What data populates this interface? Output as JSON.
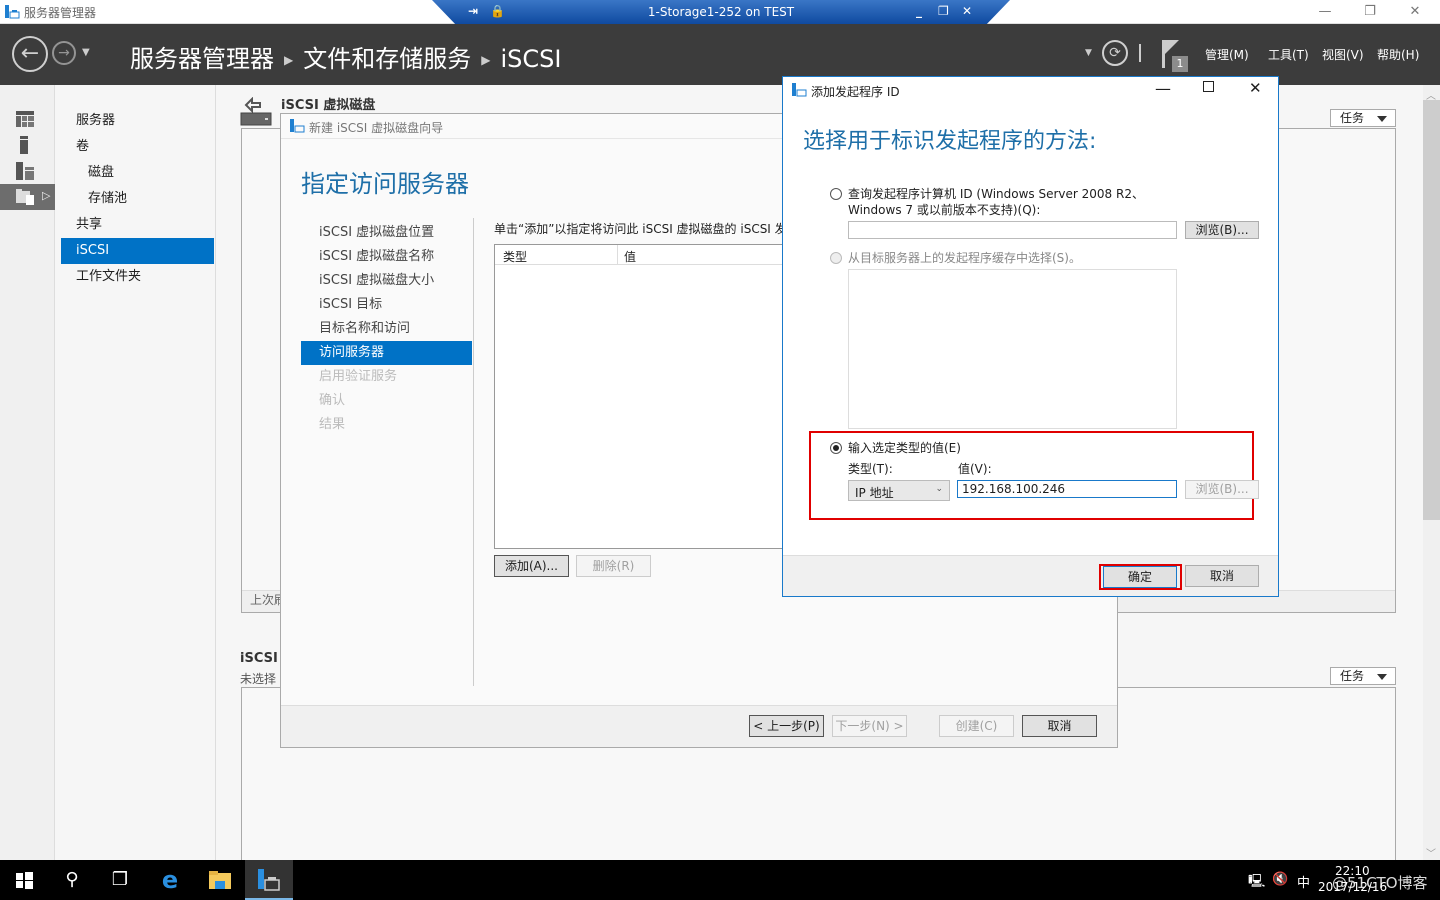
{
  "window": {
    "app_title": "服务器管理器",
    "rdp_title": "1-Storage1-252 on TEST",
    "controls": {
      "minimize": "—",
      "restore": "❐",
      "close": "✕"
    }
  },
  "header": {
    "breadcrumb": [
      "服务器管理器",
      "文件和存储服务",
      "iSCSI"
    ],
    "notification_count": "1",
    "menus": [
      "管理(M)",
      "工具(T)",
      "视图(V)",
      "帮助(H)"
    ]
  },
  "rail": {
    "items": [
      "dashboard-icon",
      "local-server-icon",
      "all-servers-icon",
      "file-storage-icon"
    ]
  },
  "nav": {
    "items": [
      {
        "label": "服务器",
        "sub": false,
        "active": false
      },
      {
        "label": "卷",
        "sub": false,
        "active": false
      },
      {
        "label": "磁盘",
        "sub": true,
        "active": false
      },
      {
        "label": "存储池",
        "sub": true,
        "active": false
      },
      {
        "label": "共享",
        "sub": false,
        "active": false
      },
      {
        "label": "iSCSI",
        "sub": false,
        "active": true
      },
      {
        "label": "工作文件夹",
        "sub": false,
        "active": false
      }
    ]
  },
  "content": {
    "section1_title": "iSCSI 虚拟磁盘",
    "section1_footer": "上次刷",
    "section2_title": "iSCSI",
    "section2_sub": "未选择",
    "tasks_label": "任务"
  },
  "wizard": {
    "title": "新建 iSCSI 虚拟磁盘向导",
    "heading": "指定访问服务器",
    "steps": [
      {
        "label": "iSCSI 虚拟磁盘位置",
        "state": "done"
      },
      {
        "label": "iSCSI 虚拟磁盘名称",
        "state": "done"
      },
      {
        "label": "iSCSI 虚拟磁盘大小",
        "state": "done"
      },
      {
        "label": "iSCSI 目标",
        "state": "done"
      },
      {
        "label": "目标名称和访问",
        "state": "done"
      },
      {
        "label": "访问服务器",
        "state": "active"
      },
      {
        "label": "启用验证服务",
        "state": "disabled"
      },
      {
        "label": "确认",
        "state": "disabled"
      },
      {
        "label": "结果",
        "state": "disabled"
      }
    ],
    "instruction": "单击“添加”以指定将访问此 iSCSI 虚拟磁盘的 iSCSI 发起程序。",
    "table_headers": [
      "类型",
      "值"
    ],
    "add_button": "添加(A)...",
    "remove_button": "删除(R)",
    "prev_button": "< 上一步(P)",
    "next_button": "下一步(N) >",
    "create_button": "创建(C)",
    "cancel_button": "取消"
  },
  "dialog": {
    "title": "添加发起程序 ID",
    "heading": "选择用于标识发起程序的方法:",
    "option1_line1": "查询发起程序计算机 ID (Windows Server 2008 R2、",
    "option1_line2": "Windows 7 或以前版本不支持)(Q):",
    "option1_value": "",
    "browse1": "浏览(B)...",
    "option2": "从目标服务器上的发起程序缓存中选择(S)。",
    "option3": "输入选定类型的值(E)",
    "type_label": "类型(T):",
    "type_value": "IP 地址",
    "value_label": "值(V):",
    "value": "192.168.100.246",
    "browse3": "浏览(B)...",
    "ok": "确定",
    "cancel": "取消",
    "selected_option": 3
  },
  "taskbar": {
    "time": "22:10",
    "date": "2017/12/16",
    "ime": "中",
    "watermark": "@51CTO博客"
  }
}
